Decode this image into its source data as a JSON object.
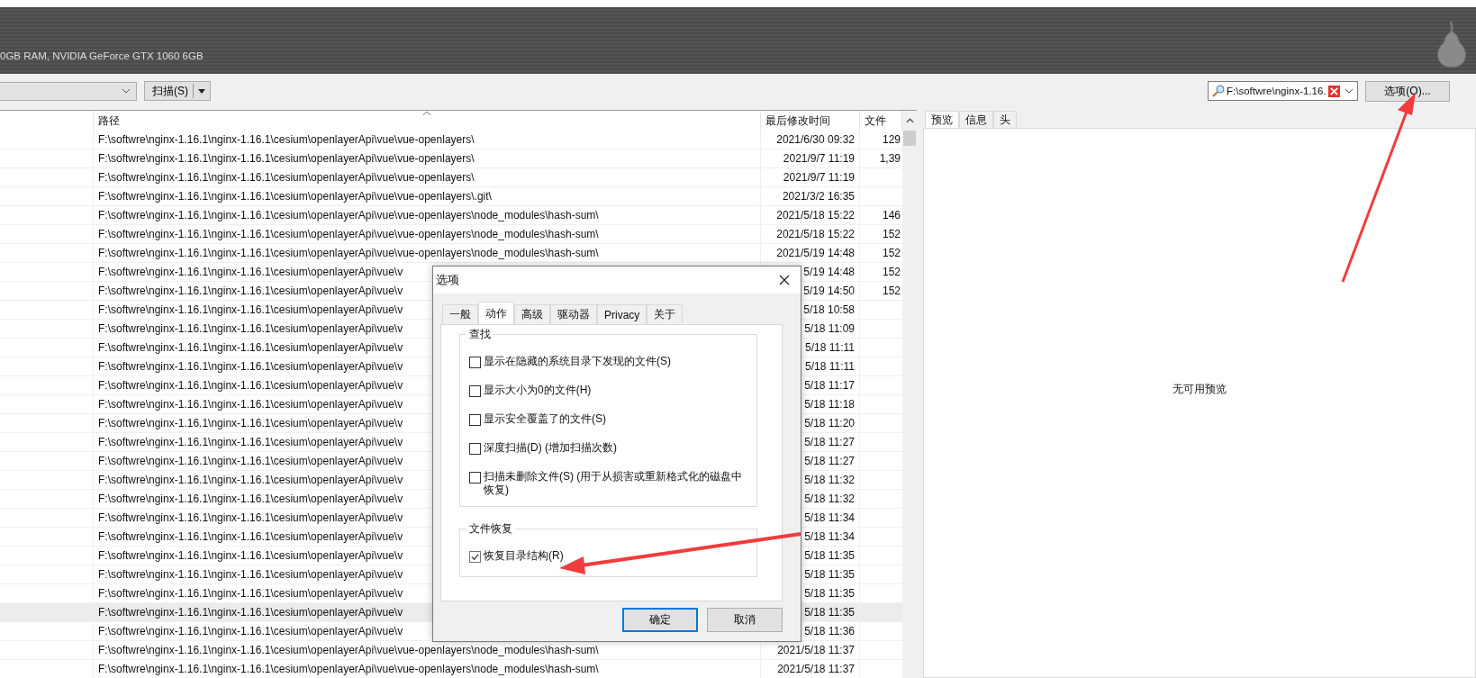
{
  "header": {
    "system_info": "0GB RAM, NVIDIA GeForce GTX 1060 6GB"
  },
  "toolbar": {
    "scan_button": "扫描(S)",
    "search": {
      "value": "F:\\softwre\\nginx-1.16."
    },
    "options_button": "选项(O)..."
  },
  "table": {
    "columns": [
      {
        "label": "路径",
        "sorted": true
      },
      {
        "label": "最后修改时间",
        "sorted": false
      },
      {
        "label": "文件",
        "sorted": false
      }
    ],
    "rows": [
      {
        "path": "F:\\softwre\\nginx-1.16.1\\nginx-1.16.1\\cesium\\openlayerApi\\vue\\vue-openlayers\\",
        "modified": "2021/6/30 09:32",
        "size": "129",
        "selected": false
      },
      {
        "path": "F:\\softwre\\nginx-1.16.1\\nginx-1.16.1\\cesium\\openlayerApi\\vue\\vue-openlayers\\",
        "modified": "2021/9/7 11:19",
        "size": "1,39",
        "selected": false
      },
      {
        "path": "F:\\softwre\\nginx-1.16.1\\nginx-1.16.1\\cesium\\openlayerApi\\vue\\vue-openlayers\\",
        "modified": "2021/9/7 11:19",
        "selected": false
      },
      {
        "path": "F:\\softwre\\nginx-1.16.1\\nginx-1.16.1\\cesium\\openlayerApi\\vue\\vue-openlayers\\.git\\",
        "modified": "2021/3/2 16:35",
        "selected": false
      },
      {
        "path": "F:\\softwre\\nginx-1.16.1\\nginx-1.16.1\\cesium\\openlayerApi\\vue\\vue-openlayers\\node_modules\\hash-sum\\",
        "modified": "2021/5/18 15:22",
        "size": "146",
        "selected": false
      },
      {
        "path": "F:\\softwre\\nginx-1.16.1\\nginx-1.16.1\\cesium\\openlayerApi\\vue\\vue-openlayers\\node_modules\\hash-sum\\",
        "modified": "2021/5/18 15:22",
        "size": "152",
        "selected": false
      },
      {
        "path": "F:\\softwre\\nginx-1.16.1\\nginx-1.16.1\\cesium\\openlayerApi\\vue\\vue-openlayers\\node_modules\\hash-sum\\",
        "modified": "2021/5/19 14:48",
        "size": "152",
        "selected": false
      },
      {
        "path": "F:\\softwre\\nginx-1.16.1\\nginx-1.16.1\\cesium\\openlayerApi\\vue\\v",
        "modified": "5/19 14:48",
        "size": "152",
        "selected": false
      },
      {
        "path": "F:\\softwre\\nginx-1.16.1\\nginx-1.16.1\\cesium\\openlayerApi\\vue\\v",
        "modified": "5/19 14:50",
        "size": "152",
        "selected": false
      },
      {
        "path": "F:\\softwre\\nginx-1.16.1\\nginx-1.16.1\\cesium\\openlayerApi\\vue\\v",
        "modified": "5/18 10:58",
        "selected": false
      },
      {
        "path": "F:\\softwre\\nginx-1.16.1\\nginx-1.16.1\\cesium\\openlayerApi\\vue\\v",
        "modified": "5/18 11:09",
        "selected": false
      },
      {
        "path": "F:\\softwre\\nginx-1.16.1\\nginx-1.16.1\\cesium\\openlayerApi\\vue\\v",
        "modified": "5/18 11:11",
        "selected": false
      },
      {
        "path": "F:\\softwre\\nginx-1.16.1\\nginx-1.16.1\\cesium\\openlayerApi\\vue\\v",
        "modified": "5/18 11:11",
        "selected": false
      },
      {
        "path": "F:\\softwre\\nginx-1.16.1\\nginx-1.16.1\\cesium\\openlayerApi\\vue\\v",
        "modified": "5/18 11:17",
        "selected": false
      },
      {
        "path": "F:\\softwre\\nginx-1.16.1\\nginx-1.16.1\\cesium\\openlayerApi\\vue\\v",
        "modified": "5/18 11:18",
        "selected": false
      },
      {
        "path": "F:\\softwre\\nginx-1.16.1\\nginx-1.16.1\\cesium\\openlayerApi\\vue\\v",
        "modified": "5/18 11:20",
        "selected": false
      },
      {
        "path": "F:\\softwre\\nginx-1.16.1\\nginx-1.16.1\\cesium\\openlayerApi\\vue\\v",
        "modified": "5/18 11:27",
        "selected": false
      },
      {
        "path": "F:\\softwre\\nginx-1.16.1\\nginx-1.16.1\\cesium\\openlayerApi\\vue\\v",
        "modified": "5/18 11:27",
        "selected": false
      },
      {
        "path": "F:\\softwre\\nginx-1.16.1\\nginx-1.16.1\\cesium\\openlayerApi\\vue\\v",
        "modified": "5/18 11:32",
        "selected": false
      },
      {
        "path": "F:\\softwre\\nginx-1.16.1\\nginx-1.16.1\\cesium\\openlayerApi\\vue\\v",
        "modified": "5/18 11:32",
        "selected": false
      },
      {
        "path": "F:\\softwre\\nginx-1.16.1\\nginx-1.16.1\\cesium\\openlayerApi\\vue\\v",
        "modified": "5/18 11:34",
        "selected": false
      },
      {
        "path": "F:\\softwre\\nginx-1.16.1\\nginx-1.16.1\\cesium\\openlayerApi\\vue\\v",
        "modified": "5/18 11:34",
        "selected": false
      },
      {
        "path": "F:\\softwre\\nginx-1.16.1\\nginx-1.16.1\\cesium\\openlayerApi\\vue\\v",
        "modified": "5/18 11:35",
        "selected": false
      },
      {
        "path": "F:\\softwre\\nginx-1.16.1\\nginx-1.16.1\\cesium\\openlayerApi\\vue\\v",
        "modified": "5/18 11:35",
        "selected": false
      },
      {
        "path": "F:\\softwre\\nginx-1.16.1\\nginx-1.16.1\\cesium\\openlayerApi\\vue\\v",
        "modified": "5/18 11:35",
        "selected": false
      },
      {
        "path": "F:\\softwre\\nginx-1.16.1\\nginx-1.16.1\\cesium\\openlayerApi\\vue\\v",
        "modified": "5/18 11:35",
        "selected": true
      },
      {
        "path": "F:\\softwre\\nginx-1.16.1\\nginx-1.16.1\\cesium\\openlayerApi\\vue\\v",
        "modified": "5/18 11:36",
        "selected": false
      },
      {
        "path": "F:\\softwre\\nginx-1.16.1\\nginx-1.16.1\\cesium\\openlayerApi\\vue\\vue-openlayers\\node_modules\\hash-sum\\",
        "modified": "2021/5/18 11:37",
        "selected": false
      },
      {
        "path": "F:\\softwre\\nginx-1.16.1\\nginx-1.16.1\\cesium\\openlayerApi\\vue\\vue-openlayers\\node_modules\\hash-sum\\",
        "modified": "2021/5/18 11:37",
        "selected": false
      }
    ]
  },
  "preview": {
    "tabs": [
      {
        "label": "预览",
        "selected": true
      },
      {
        "label": "信息",
        "selected": false
      },
      {
        "label": "头",
        "selected": false
      }
    ],
    "message": "无可用预览"
  },
  "dialog": {
    "title": "选项",
    "tabs": [
      {
        "label": "一般",
        "selected": false
      },
      {
        "label": "动作",
        "selected": true
      },
      {
        "label": "高级",
        "selected": false
      },
      {
        "label": "驱动器",
        "selected": false
      },
      {
        "label": "Privacy",
        "selected": false
      },
      {
        "label": "关于",
        "selected": false
      }
    ],
    "groups": [
      {
        "title": "查找",
        "options": [
          {
            "label": "显示在隐藏的系统目录下发现的文件(S)",
            "checked": false
          },
          {
            "label": "显示大小为0的文件(H)",
            "checked": false
          },
          {
            "label": "显示安全覆盖了的文件(S)",
            "checked": false
          },
          {
            "label": "深度扫描(D) (增加扫描次数)",
            "checked": false
          },
          {
            "label": "扫描未删除文件(S) (用于从损害或重新格式化的磁盘中恢复)",
            "checked": false
          }
        ]
      },
      {
        "title": "文件恢复",
        "options": [
          {
            "label": "恢复目录结构(R)",
            "checked": true
          }
        ]
      }
    ],
    "buttons": [
      {
        "label": "确定",
        "default": true
      },
      {
        "label": "取消",
        "default": false
      }
    ]
  }
}
